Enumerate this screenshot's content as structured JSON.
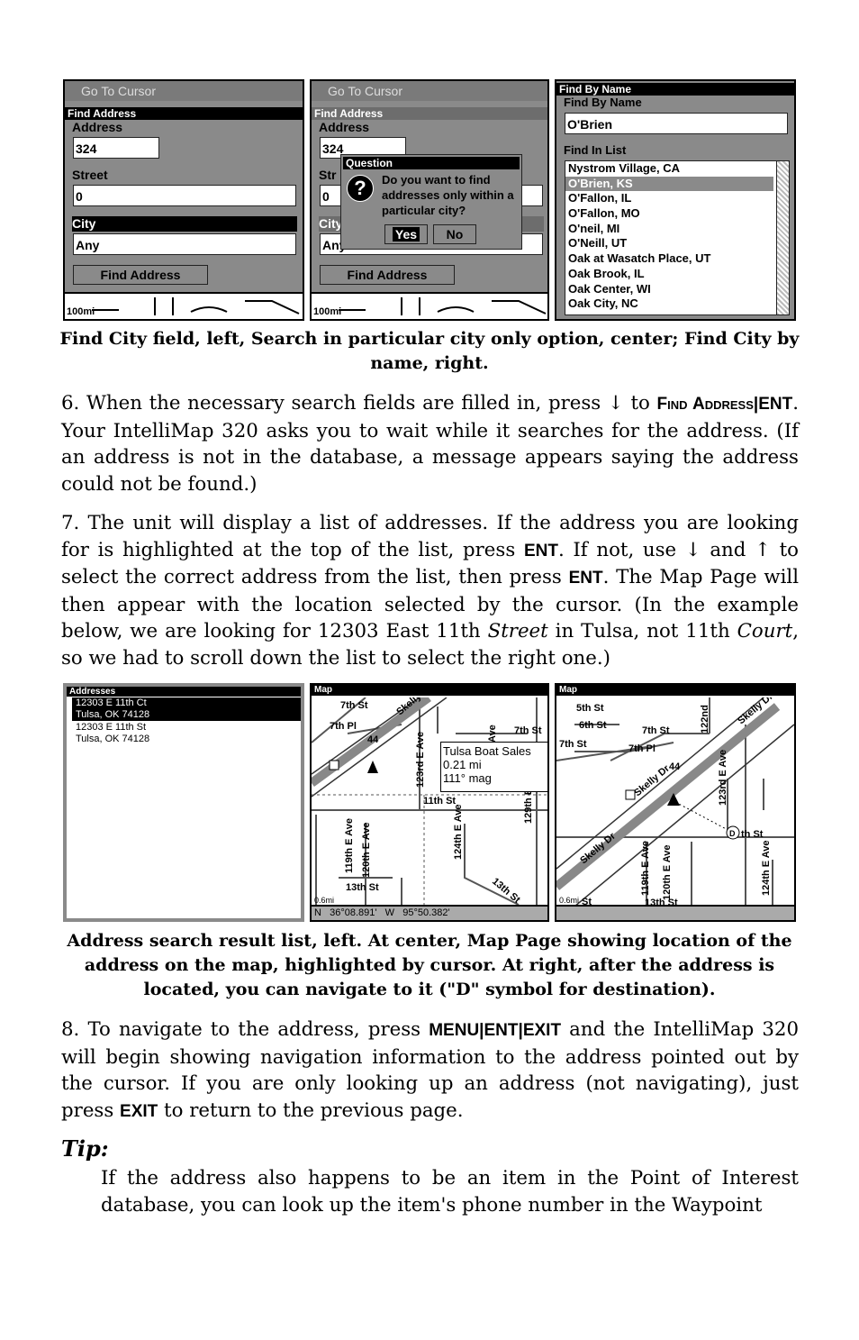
{
  "fig1": {
    "left": {
      "ghost_title": "Go To Cursor",
      "title": "Find Address",
      "address_label": "Address",
      "address_value": "324",
      "street_label": "Street",
      "street_value": "0",
      "city_label": "City",
      "city_value": "Any",
      "button": "Find Address",
      "scale": "100mi"
    },
    "center": {
      "ghost_title": "Go To Cursor",
      "title": "Find Address",
      "address_label": "Address",
      "address_value": "324",
      "street_label": "Str",
      "street_value": "0",
      "city_label": "City",
      "city_value": "Any",
      "button": "Find Address",
      "scale": "100mi",
      "dialog": {
        "title": "Question",
        "icon": "question-icon",
        "message": "Do you want to find addresses only within a particular city?",
        "yes": "Yes",
        "no": "No"
      }
    },
    "right": {
      "title": "Find By Name",
      "name_label": "Find By Name",
      "name_value": "O'Brien",
      "list_label": "Find In List",
      "items": [
        "Nystrom Village, CA",
        "O'Brien, KS",
        "O'Fallon, IL",
        "O'Fallon, MO",
        "O'neil, MI",
        "O'Neill, UT",
        "Oak at Wasatch Place, UT",
        "Oak Brook, IL",
        "Oak Center, WI",
        "Oak City, NC"
      ],
      "selected_index": 1
    },
    "caption": "Find City field, left, Search in particular city only option, center; Find City by name, right."
  },
  "para6": {
    "t1": "6. When the necessary search fields are filled in, press ↓ to ",
    "k1": "Find Address",
    "sep": "|",
    "k2": "ENT",
    "t2": ". Your IntelliMap 320 asks you to wait while it searches for the address. (If an address is not in the database, a message appears saying the address could not be found.)"
  },
  "para7": {
    "t1": "7. The unit will display a list of addresses. If the address you are looking for is highlighted at the top of the list, press ",
    "k1": "ENT",
    "t2": ". If not, use ↓ and ↑ to select the correct address from the list, then press ",
    "k2": "ENT",
    "t3": ". The Map Page will then appear with the location selected by the cursor. (In the example below, we are looking for 12303 East 11th ",
    "i1": "Street",
    "t4": " in Tulsa, not 11th ",
    "i2": "Court",
    "t5": ", so we had to scroll down the list to select the right one.)"
  },
  "fig2": {
    "list": {
      "title": "Addresses",
      "items": [
        {
          "line1": "12303 E 11th Ct",
          "line2": "Tulsa, OK  74128"
        },
        {
          "line1": "12303 E 11th St",
          "line2": "Tulsa, OK  74128"
        }
      ],
      "selected_index": 0
    },
    "map_center": {
      "title": "Map",
      "labels": [
        "7th St",
        "7th Pl",
        "Skelly Dr",
        "44",
        "123rd E Ave",
        "E Ave",
        "7th St",
        "11th St",
        "129th E",
        "119th E Ave",
        "120th E Ave",
        "124th E Ave",
        "13th St",
        "13th St",
        "0.6mi"
      ],
      "popup": {
        "name": "Tulsa Boat Sales",
        "distance": "0.21 mi",
        "bearing": "111° mag"
      },
      "coords": "N   36°08.891'   W   95°50.382'"
    },
    "map_right": {
      "title": "Map",
      "labels": [
        "5th St",
        "6th St",
        "7th St",
        "7th Pl",
        "7th St",
        "122nd",
        "Skelly Dr",
        "44",
        "123rd E Ave",
        "Skelly Dr",
        "Skelly Dr",
        "th St",
        "119th E Ave",
        "120th E Ave",
        "124th E Ave",
        "13th St",
        "0.6mi",
        "St"
      ],
      "destination": "D"
    },
    "caption": "Address search result list, left. At center, Map Page showing location of the address on the map, highlighted by cursor. At right, after the address is located, you can navigate to it (\"D\" symbol for destination)."
  },
  "para8": {
    "t1": "8. To navigate to the address, press ",
    "k1": "MENU",
    "s1": "|",
    "k2": "ENT",
    "s2": "|",
    "k3": "EXIT",
    "t2": " and the IntelliMap 320 will begin showing navigation information to the address pointed out by the cursor. If you are only looking up an address (not navigating), just press ",
    "k4": "EXIT",
    "t3": " to return to the previous page."
  },
  "tip": {
    "heading": "Tip:",
    "text": "If the address also happens to be an item in the Point of Interest database, you can look up the item's phone number in the Waypoint"
  }
}
